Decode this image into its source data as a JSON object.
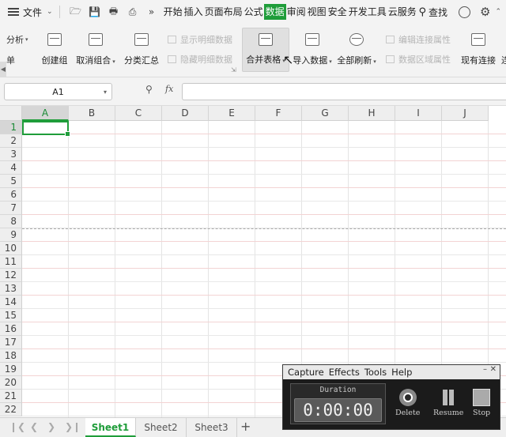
{
  "menubar": {
    "file_label": "文件",
    "tabs": [
      "开始",
      "插入",
      "页面布局",
      "公式",
      "数据",
      "审阅",
      "视图",
      "安全",
      "开发工具",
      "云服务"
    ],
    "active_tab": "数据",
    "search_label": "查找"
  },
  "ribbon": {
    "partial_left_top": "分析",
    "partial_left_bottom": "单",
    "create_group": "创建组",
    "ungroup": "取消组合",
    "subtotal": "分类汇总",
    "show_detail": "显示明细数据",
    "hide_detail": "隐藏明细数据",
    "merge_sheets": "合并表格",
    "import_data": "导入数据",
    "refresh_all": "全部刷新",
    "edit_links": "编辑连接属性",
    "data_range_props": "数据区域属性",
    "existing_connections": "现有连接",
    "partial_right": "连"
  },
  "formula_bar": {
    "name_box": "A1",
    "fx_label": "fx",
    "formula_value": ""
  },
  "grid": {
    "columns": [
      "A",
      "B",
      "C",
      "D",
      "E",
      "F",
      "G",
      "H",
      "I",
      "J"
    ],
    "rows": [
      "1",
      "2",
      "3",
      "4",
      "5",
      "6",
      "7",
      "8",
      "9",
      "10",
      "11",
      "12",
      "13",
      "14",
      "15",
      "16",
      "17",
      "18",
      "19",
      "20",
      "21",
      "22"
    ],
    "selected_cell": "A1"
  },
  "sheets": {
    "tabs": [
      "Sheet1",
      "Sheet2",
      "Sheet3"
    ],
    "active": "Sheet1",
    "add_label": "+"
  },
  "capture": {
    "menu": [
      "Capture",
      "Effects",
      "Tools",
      "Help"
    ],
    "duration_label": "Duration",
    "duration_value": "0:00:00",
    "delete_label": "Delete",
    "resume_label": "Resume",
    "stop_label": "Stop"
  },
  "colors": {
    "accent": "#1f9d3a",
    "ribbon_bg": "#f3f3f3",
    "capture_bg": "#1b1b1b"
  }
}
